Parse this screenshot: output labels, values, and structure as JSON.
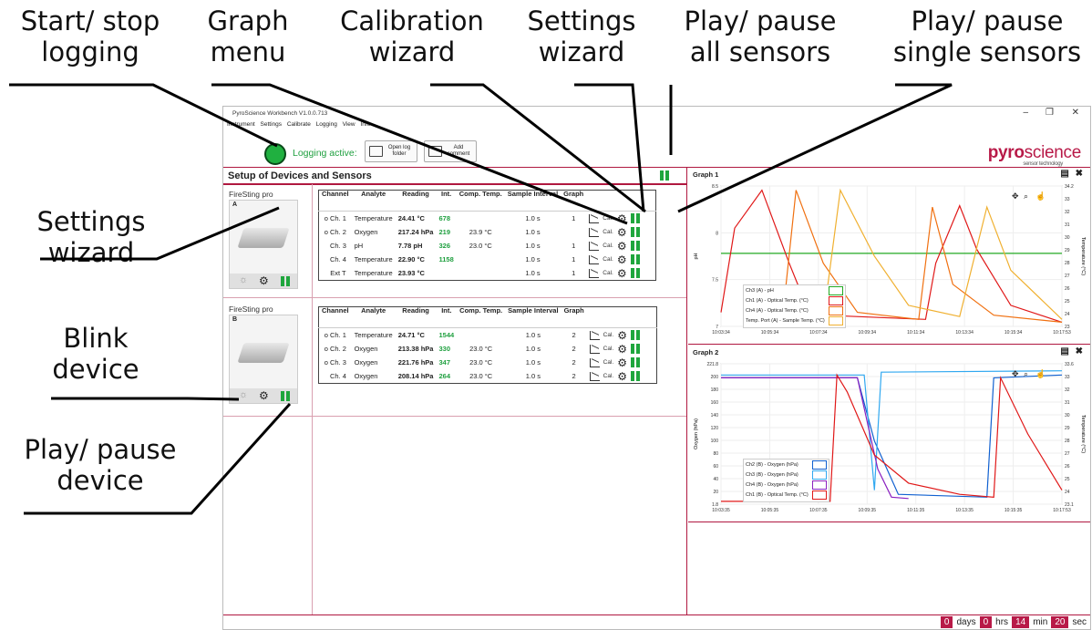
{
  "callouts": {
    "start_stop": "Start/ stop\nlogging",
    "graph_menu": "Graph\nmenu",
    "calibration": "Calibration\nwizard",
    "settings_top": "Settings\nwizard",
    "play_all": "Play/ pause\nall sensors",
    "play_single": "Play/ pause\nsingle sensors",
    "settings_left": "Settings\nwizard",
    "blink": "Blink\ndevice",
    "play_device": "Play/ pause\ndevice"
  },
  "window": {
    "title": "PyroScience Workbench V1.0.0.713",
    "menu": [
      "Instrument",
      "Settings",
      "Calibrate",
      "Logging",
      "View",
      "Info"
    ],
    "logging_text": "Logging active:",
    "open_log": "Open log folder",
    "add_comment": "Add comment",
    "logo": {
      "part1": "pyro",
      "part2": "science",
      "sub": "sensor technology"
    },
    "colors": {
      "accent": "#b81a48",
      "green": "#20a040"
    }
  },
  "setup": {
    "title": "Setup of Devices and Sensors",
    "headers": [
      "Channel",
      "Analyte",
      "Reading",
      "Int.",
      "Comp. Temp.",
      "Sample Interval",
      "Graph"
    ],
    "cal_label": "Cal.",
    "devices": [
      {
        "name": "FireSting pro",
        "letter": "A",
        "rows": [
          {
            "ch": "Ch. 1",
            "mark": "o",
            "analyte": "Temperature",
            "reading": "24.41 °C",
            "int": "678",
            "comp": "",
            "interval": "1.0 s",
            "graph": "1"
          },
          {
            "ch": "Ch. 2",
            "mark": "o",
            "analyte": "Oxygen",
            "reading": "217.24 hPa",
            "int": "219",
            "comp": "23.9 °C",
            "interval": "1.0 s",
            "graph": ""
          },
          {
            "ch": "Ch. 3",
            "mark": "",
            "analyte": "pH",
            "reading": "7.78 pH",
            "int": "326",
            "comp": "23.0 °C",
            "interval": "1.0 s",
            "graph": "1"
          },
          {
            "ch": "Ch. 4",
            "mark": "",
            "analyte": "Temperature",
            "reading": "22.90 °C",
            "int": "1158",
            "comp": "",
            "interval": "1.0 s",
            "graph": "1"
          },
          {
            "ch": "Ext T",
            "mark": "",
            "analyte": "Temperature",
            "reading": "23.93 °C",
            "int": "",
            "comp": "",
            "interval": "1.0 s",
            "graph": "1"
          }
        ]
      },
      {
        "name": "FireSting pro",
        "letter": "B",
        "rows": [
          {
            "ch": "Ch. 1",
            "mark": "o",
            "analyte": "Temperature",
            "reading": "24.71 °C",
            "int": "1544",
            "comp": "",
            "interval": "1.0 s",
            "graph": "2"
          },
          {
            "ch": "Ch. 2",
            "mark": "o",
            "analyte": "Oxygen",
            "reading": "213.38 hPa",
            "int": "330",
            "comp": "23.0 °C",
            "interval": "1.0 s",
            "graph": "2"
          },
          {
            "ch": "Ch. 3",
            "mark": "o",
            "analyte": "Oxygen",
            "reading": "221.76 hPa",
            "int": "347",
            "comp": "23.0 °C",
            "interval": "1.0 s",
            "graph": "2"
          },
          {
            "ch": "Ch. 4",
            "mark": "",
            "analyte": "Oxygen",
            "reading": "208.14 hPa",
            "int": "264",
            "comp": "23.0 °C",
            "interval": "1.0 s",
            "graph": "2"
          }
        ]
      }
    ]
  },
  "graph1": {
    "title": "Graph 1",
    "yleft": "pH",
    "yright": "Temperature (°C)",
    "left_ticks": [
      "8.5",
      "8",
      "7.5",
      "7"
    ],
    "right_ticks": [
      "34.2",
      "33",
      "32",
      "31",
      "30",
      "29",
      "28",
      "27",
      "26",
      "25",
      "24",
      "23"
    ],
    "x_ticks": [
      "10:03:34",
      "10:05:34",
      "10:07:34",
      "10:09:34",
      "10:11:34",
      "10:13:34",
      "10:15:34",
      "10:17:53"
    ],
    "legend": [
      {
        "label": "Ch3 (A) - pH",
        "color": "#22aa22"
      },
      {
        "label": "Ch1 (A) - Optical Temp. (°C)",
        "color": "#e01818"
      },
      {
        "label": "Ch4 (A) - Optical Temp. (°C)",
        "color": "#f07010"
      },
      {
        "label": "Temp. Port (A) - Sample Temp. (°C)",
        "color": "#f0b030"
      }
    ]
  },
  "graph2": {
    "title": "Graph 2",
    "yleft": "Oxygen (hPa)",
    "yright": "Temperature (°C)",
    "left_ticks": [
      "221.8",
      "200",
      "180",
      "160",
      "140",
      "120",
      "100",
      "80",
      "60",
      "40",
      "20",
      "1.8"
    ],
    "right_ticks": [
      "33.6",
      "33",
      "32",
      "31",
      "30",
      "29",
      "28",
      "27",
      "26",
      "25",
      "24",
      "23.1"
    ],
    "x_ticks": [
      "10:03:35",
      "10:05:35",
      "10:07:35",
      "10:09:35",
      "10:11:35",
      "10:13:35",
      "10:15:35",
      "10:17:53"
    ],
    "legend": [
      {
        "label": "Ch2 (B) - Oxygen (hPa)",
        "color": "#1060d0"
      },
      {
        "label": "Ch3 (B) - Oxygen (hPa)",
        "color": "#30a8f0"
      },
      {
        "label": "Ch4 (B) - Oxygen (hPa)",
        "color": "#8a20c0"
      },
      {
        "label": "Ch1 (B) - Optical Temp. (°C)",
        "color": "#e01818"
      }
    ]
  },
  "timer": {
    "days": "0",
    "days_label": "days",
    "hrs": "0",
    "hrs_label": "hrs",
    "min": "14",
    "min_label": "min",
    "sec": "20",
    "sec_label": "sec"
  }
}
